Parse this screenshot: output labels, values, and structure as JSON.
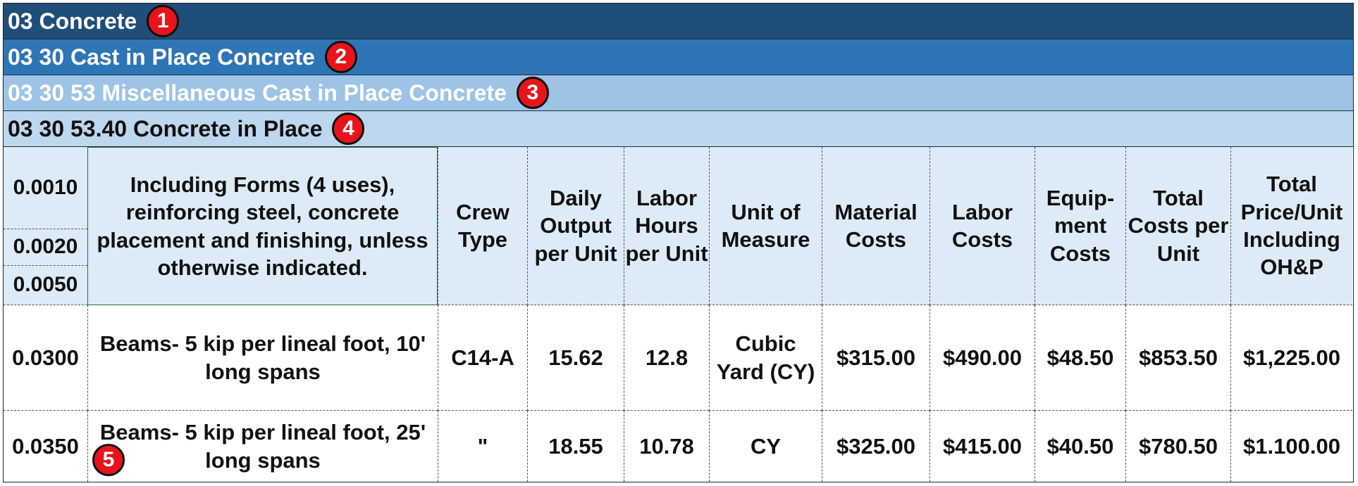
{
  "headers": [
    {
      "text": "03 Concrete",
      "badge": "1"
    },
    {
      "text": "03 30 Cast in Place Concrete",
      "badge": "2"
    },
    {
      "text": "03 30 53 Miscellaneous Cast in Place Concrete",
      "badge": "3"
    },
    {
      "text": "03 30 53.40 Concrete in Place",
      "badge": "4"
    }
  ],
  "column_header": {
    "codes": [
      "0.0010",
      "0.0020",
      "0.0050"
    ],
    "description": "Including Forms (4 uses), reinforcing steel, concrete placement and finishing, unless otherwise indicated.",
    "crew_type": "Crew Type",
    "daily_output": "Daily Output per Unit",
    "labor_hours": "Labor Hours per Unit",
    "unit": "Unit of Measure",
    "material": "Material Costs",
    "labor": "Labor Costs",
    "equipment": "Equip-ment Costs",
    "total": "Total Costs per Unit",
    "total_op": "Total Price/Unit Including OH&P"
  },
  "rows": [
    {
      "code": "0.0300",
      "description": "Beams- 5 kip per lineal foot, 10' long spans",
      "crew": "C14-A",
      "output": "15.62",
      "hours": "12.8",
      "unit": "Cubic Yard (CY)",
      "material": "$315.00",
      "labor": "$490.00",
      "equipment": "$48.50",
      "total": "$853.50",
      "total_op": "$1,225.00"
    },
    {
      "code": "0.0350",
      "description": "Beams- 5 kip per lineal foot, 25' long spans",
      "crew": "\"",
      "output": "18.55",
      "hours": "10.78",
      "unit": "CY",
      "material": "$325.00",
      "labor": "$415.00",
      "equipment": "$40.50",
      "total": "$780.50",
      "total_op": "$1.100.00"
    }
  ],
  "row_badge": "5",
  "colors": {
    "header1": "#1f4e79",
    "header2": "#2e75b6",
    "header3": "#9dc3e6",
    "header4": "#bdd7ee",
    "column_header": "#ddebf7",
    "badge": "#e8141b"
  }
}
